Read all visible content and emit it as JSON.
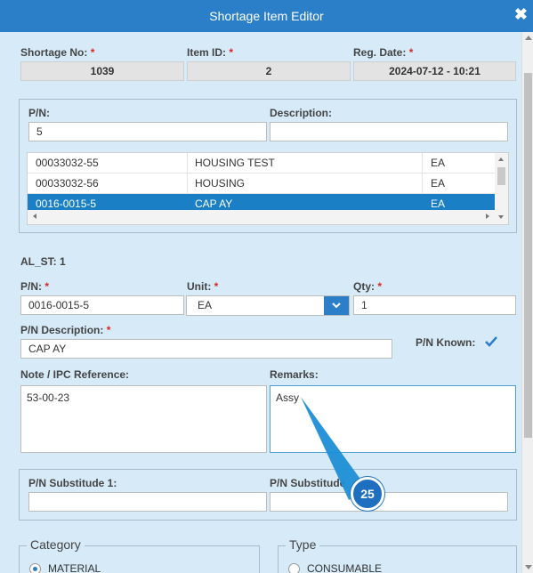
{
  "window": {
    "title": "Shortage Item Editor",
    "close_glyph": "✖"
  },
  "header": {
    "shortage_no_label": "Shortage No:",
    "shortage_no": "1039",
    "item_id_label": "Item ID:",
    "item_id": "2",
    "reg_date_label": "Reg. Date:",
    "reg_date": "2024-07-12 - 10:21",
    "required_mark": "*"
  },
  "search": {
    "pn_label": "P/N:",
    "pn_value": "5",
    "description_label": "Description:",
    "description_value": ""
  },
  "grid": {
    "rows": [
      {
        "pn": "00033032-55",
        "description": "HOUSING TEST",
        "unit": "EA",
        "selected": false
      },
      {
        "pn": "00033032-56",
        "description": "HOUSING",
        "unit": "EA",
        "selected": false
      },
      {
        "pn": "0016-0015-5",
        "description": "CAP AY",
        "unit": "EA",
        "selected": true
      }
    ]
  },
  "al_st": "AL_ST: 1",
  "item": {
    "pn_label": "P/N:",
    "pn_value": "0016-0015-5",
    "unit_label": "Unit:",
    "unit_value": "EA",
    "qty_label": "Qty:",
    "qty_value": "1",
    "pn_desc_label": "P/N Description:",
    "pn_desc_value": "CAP AY",
    "pn_known_label": "P/N Known:",
    "pn_known_checked": true,
    "note_label": "Note / IPC Reference:",
    "note_value": "53-00-23",
    "remarks_label": "Remarks:",
    "remarks_value": "Assy"
  },
  "substitutes": {
    "sub1_label": "P/N Substitude 1:",
    "sub1_value": "",
    "sub2_label": "P/N Substitude",
    "sub2_value": ""
  },
  "category": {
    "legend": "Category",
    "option": "MATERIAL"
  },
  "type": {
    "legend": "Type",
    "option": "CONSUMABLE"
  },
  "annotation": {
    "label": "25",
    "color": "#1e6fbf"
  },
  "colors": {
    "titlebar": "#2a7fc8",
    "background": "#d6eaf8",
    "selected_row": "#1b7fc6",
    "required": "#d62828"
  }
}
